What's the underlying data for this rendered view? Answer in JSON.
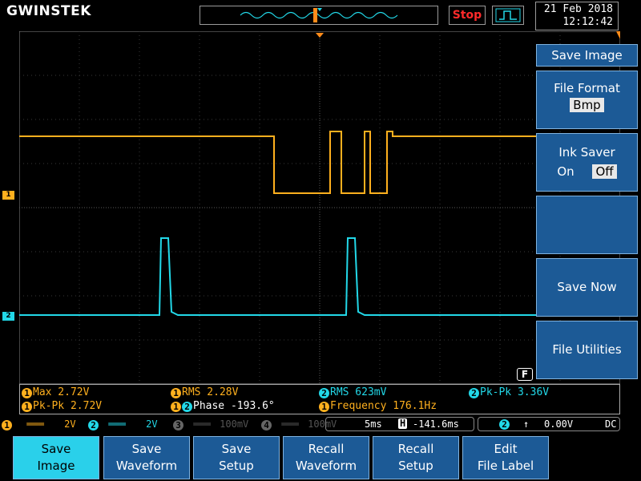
{
  "header": {
    "logo": "GWINSTEK",
    "run_state": "Stop",
    "date": "21 Feb 2018",
    "time": "12:12:42"
  },
  "channels": {
    "ch1": {
      "marker": "1",
      "color": "#ffb01e"
    },
    "ch2": {
      "marker": "2",
      "color": "#22d8e8"
    }
  },
  "side_menu": {
    "title": "Save Image",
    "file_format": {
      "label": "File Format",
      "value": "Bmp"
    },
    "ink_saver": {
      "label": "Ink Saver",
      "option_on": "On",
      "option_off": "Off",
      "selected": "Off"
    },
    "save_now": "Save Now",
    "file_utilities": "File Utilities",
    "f_indicator": "F"
  },
  "measurements": [
    {
      "ch": "1",
      "text": "Max 2.72V"
    },
    {
      "ch": "1",
      "text": "RMS 2.28V"
    },
    {
      "ch": "2",
      "text": "RMS 623mV"
    },
    {
      "ch": "2",
      "text": "Pk-Pk 3.36V"
    },
    {
      "ch": "1",
      "text": "Pk-Pk 2.72V"
    },
    {
      "ch": "12",
      "text": "Phase -193.6°"
    },
    {
      "ch": "1",
      "text": "Frequency 176.1Hz"
    }
  ],
  "status": {
    "ch1": {
      "num": "1",
      "coupling": "═══",
      "scale": "2V"
    },
    "ch2": {
      "num": "2",
      "coupling": "═══",
      "scale": "2V"
    },
    "ch3": {
      "num": "3",
      "coupling": "═══",
      "scale": "100mV"
    },
    "ch4": {
      "num": "4",
      "coupling": "═══",
      "scale": "100mV"
    },
    "timebase": "5ms",
    "position_icon": "H",
    "position": "-141.6ms",
    "trigger_source": "2",
    "trigger_slope": "↑",
    "trigger_level": "0.00V",
    "trigger_coupling": "DC"
  },
  "bottom_menu": [
    {
      "line1": "Save",
      "line2": "Image",
      "active": true
    },
    {
      "line1": "Save",
      "line2": "Waveform",
      "active": false
    },
    {
      "line1": "Save",
      "line2": "Setup",
      "active": false
    },
    {
      "line1": "Recall",
      "line2": "Waveform",
      "active": false
    },
    {
      "line1": "Recall",
      "line2": "Setup",
      "active": false
    },
    {
      "line1": "Edit",
      "line2": "File Label",
      "active": false
    }
  ]
}
